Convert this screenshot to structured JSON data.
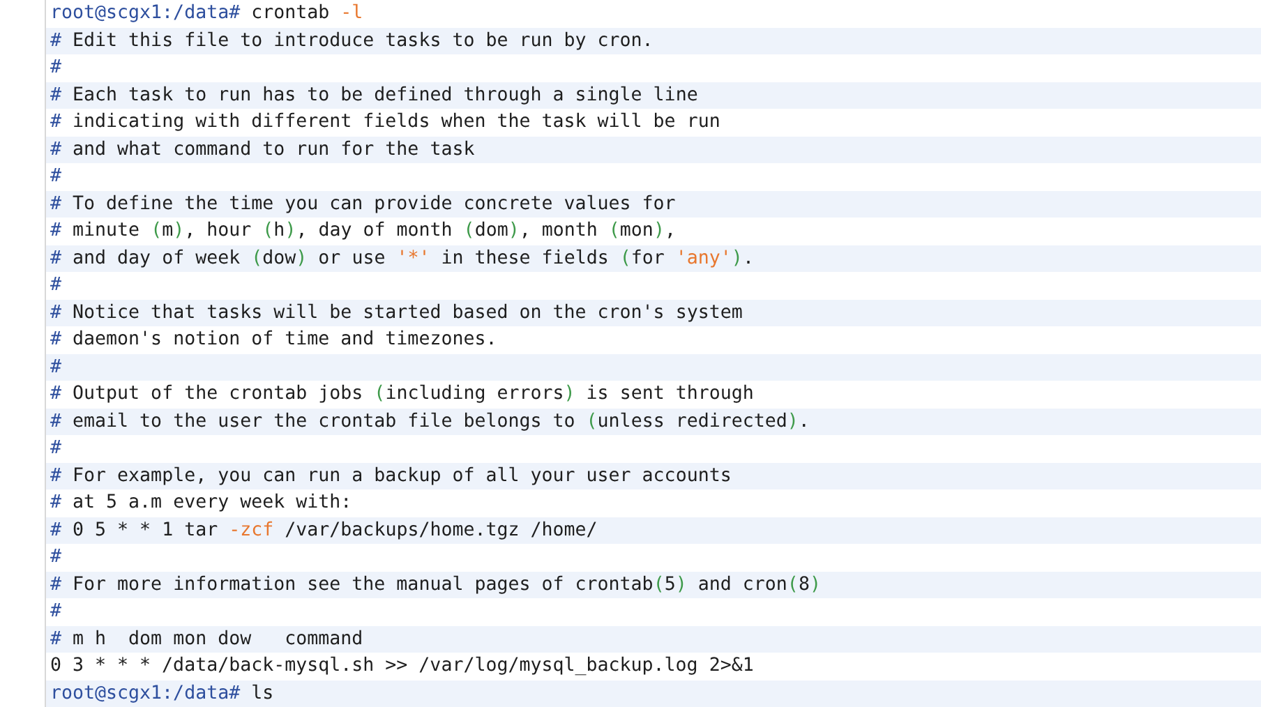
{
  "terminal": {
    "lines": [
      {
        "segments": [
          {
            "kind": "prompt",
            "text": "root@scgx1:/data#"
          },
          {
            "kind": "text",
            "text": " crontab "
          },
          {
            "kind": "flag",
            "text": "-l"
          }
        ]
      },
      {
        "segments": [
          {
            "kind": "hash",
            "text": "#"
          },
          {
            "kind": "text",
            "text": " Edit this file to introduce tasks to be run by cron."
          }
        ]
      },
      {
        "segments": [
          {
            "kind": "hash",
            "text": "#"
          }
        ]
      },
      {
        "segments": [
          {
            "kind": "hash",
            "text": "#"
          },
          {
            "kind": "text",
            "text": " Each task to run has to be defined through a single line"
          }
        ]
      },
      {
        "segments": [
          {
            "kind": "hash",
            "text": "#"
          },
          {
            "kind": "text",
            "text": " indicating with different fields when the task will be run"
          }
        ]
      },
      {
        "segments": [
          {
            "kind": "hash",
            "text": "#"
          },
          {
            "kind": "text",
            "text": " and what command to run for the task"
          }
        ]
      },
      {
        "segments": [
          {
            "kind": "hash",
            "text": "#"
          }
        ]
      },
      {
        "segments": [
          {
            "kind": "hash",
            "text": "#"
          },
          {
            "kind": "text",
            "text": " To define the time you can provide concrete values for"
          }
        ]
      },
      {
        "segments": [
          {
            "kind": "hash",
            "text": "#"
          },
          {
            "kind": "text",
            "text": " minute "
          },
          {
            "kind": "paren",
            "text": "("
          },
          {
            "kind": "text",
            "text": "m"
          },
          {
            "kind": "paren",
            "text": ")"
          },
          {
            "kind": "text",
            "text": ", hour "
          },
          {
            "kind": "paren",
            "text": "("
          },
          {
            "kind": "text",
            "text": "h"
          },
          {
            "kind": "paren",
            "text": ")"
          },
          {
            "kind": "text",
            "text": ", day of month "
          },
          {
            "kind": "paren",
            "text": "("
          },
          {
            "kind": "text",
            "text": "dom"
          },
          {
            "kind": "paren",
            "text": ")"
          },
          {
            "kind": "text",
            "text": ", month "
          },
          {
            "kind": "paren",
            "text": "("
          },
          {
            "kind": "text",
            "text": "mon"
          },
          {
            "kind": "paren",
            "text": ")"
          },
          {
            "kind": "text",
            "text": ","
          }
        ]
      },
      {
        "segments": [
          {
            "kind": "hash",
            "text": "#"
          },
          {
            "kind": "text",
            "text": " and day of week "
          },
          {
            "kind": "paren",
            "text": "("
          },
          {
            "kind": "text",
            "text": "dow"
          },
          {
            "kind": "paren",
            "text": ")"
          },
          {
            "kind": "text",
            "text": " or use "
          },
          {
            "kind": "flag",
            "text": "'*'"
          },
          {
            "kind": "text",
            "text": " in these fields "
          },
          {
            "kind": "paren",
            "text": "("
          },
          {
            "kind": "text",
            "text": "for "
          },
          {
            "kind": "flag",
            "text": "'any'"
          },
          {
            "kind": "paren",
            "text": ")"
          },
          {
            "kind": "text",
            "text": "."
          }
        ]
      },
      {
        "segments": [
          {
            "kind": "hash",
            "text": "#"
          }
        ]
      },
      {
        "segments": [
          {
            "kind": "hash",
            "text": "#"
          },
          {
            "kind": "text",
            "text": " Notice that tasks will be started based on the cron's system"
          }
        ]
      },
      {
        "segments": [
          {
            "kind": "hash",
            "text": "#"
          },
          {
            "kind": "text",
            "text": " daemon's notion of time and timezones."
          }
        ]
      },
      {
        "segments": [
          {
            "kind": "hash",
            "text": "#"
          }
        ]
      },
      {
        "segments": [
          {
            "kind": "hash",
            "text": "#"
          },
          {
            "kind": "text",
            "text": " Output of the crontab jobs "
          },
          {
            "kind": "paren",
            "text": "("
          },
          {
            "kind": "text",
            "text": "including errors"
          },
          {
            "kind": "paren",
            "text": ")"
          },
          {
            "kind": "text",
            "text": " is sent through"
          }
        ]
      },
      {
        "segments": [
          {
            "kind": "hash",
            "text": "#"
          },
          {
            "kind": "text",
            "text": " email to the user the crontab file belongs to "
          },
          {
            "kind": "paren",
            "text": "("
          },
          {
            "kind": "text",
            "text": "unless redirected"
          },
          {
            "kind": "paren",
            "text": ")"
          },
          {
            "kind": "text",
            "text": "."
          }
        ]
      },
      {
        "segments": [
          {
            "kind": "hash",
            "text": "#"
          }
        ]
      },
      {
        "segments": [
          {
            "kind": "hash",
            "text": "#"
          },
          {
            "kind": "text",
            "text": " For example, you can run a backup of all your user accounts"
          }
        ]
      },
      {
        "segments": [
          {
            "kind": "hash",
            "text": "#"
          },
          {
            "kind": "text",
            "text": " at 5 a.m every week with:"
          }
        ]
      },
      {
        "segments": [
          {
            "kind": "hash",
            "text": "#"
          },
          {
            "kind": "text",
            "text": " 0 5 * * 1 tar "
          },
          {
            "kind": "flag",
            "text": "-zcf"
          },
          {
            "kind": "text",
            "text": " /var/backups/home.tgz /home/"
          }
        ]
      },
      {
        "segments": [
          {
            "kind": "hash",
            "text": "#"
          }
        ]
      },
      {
        "segments": [
          {
            "kind": "hash",
            "text": "#"
          },
          {
            "kind": "text",
            "text": " For more information see the manual pages of crontab"
          },
          {
            "kind": "paren",
            "text": "("
          },
          {
            "kind": "text",
            "text": "5"
          },
          {
            "kind": "paren",
            "text": ")"
          },
          {
            "kind": "text",
            "text": " and cron"
          },
          {
            "kind": "paren",
            "text": "("
          },
          {
            "kind": "text",
            "text": "8"
          },
          {
            "kind": "paren",
            "text": ")"
          }
        ]
      },
      {
        "segments": [
          {
            "kind": "hash",
            "text": "#"
          }
        ]
      },
      {
        "segments": [
          {
            "kind": "hash",
            "text": "#"
          },
          {
            "kind": "text",
            "text": " m h  dom mon dow   command"
          }
        ]
      },
      {
        "segments": [
          {
            "kind": "text",
            "text": "0 3 * * * /data/back-mysql.sh >> /var/log/mysql_backup.log 2>&1"
          }
        ]
      },
      {
        "segments": [
          {
            "kind": "prompt",
            "text": "root@scgx1:/data#"
          },
          {
            "kind": "text",
            "text": " ls"
          }
        ]
      }
    ]
  }
}
